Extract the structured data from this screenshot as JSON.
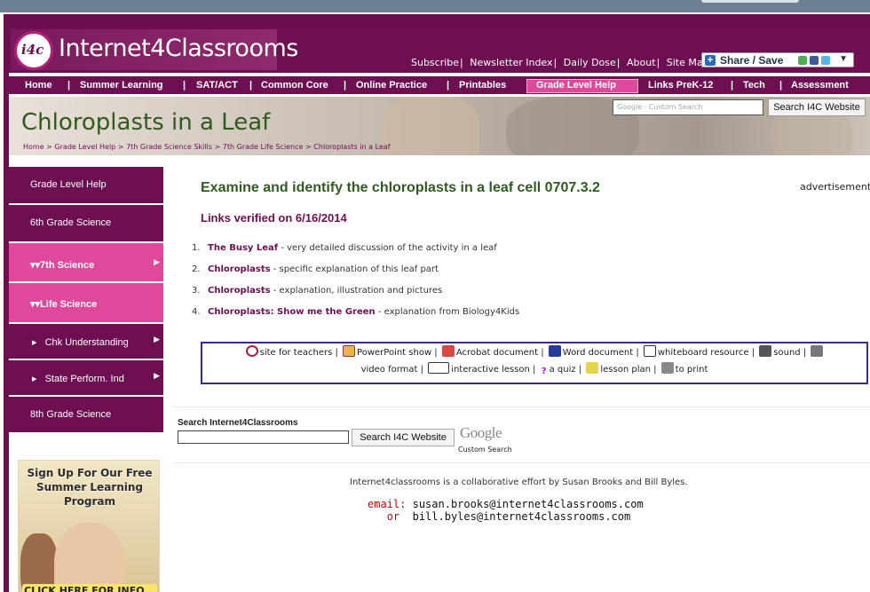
{
  "header": {
    "logo_mark": "i4c",
    "logo_text": "Internet4Classrooms",
    "top_links": [
      "Subscribe",
      "Newsletter Index",
      "Daily Dose",
      "About",
      "Site Map"
    ],
    "share_label": "Share / Save"
  },
  "nav": [
    {
      "label": "Home"
    },
    {
      "label": "Summer Learning"
    },
    {
      "label": "SAT/ACT"
    },
    {
      "label": "Common Core"
    },
    {
      "label": "Online Practice"
    },
    {
      "label": "Printables"
    },
    {
      "label": "Grade Level Help"
    },
    {
      "label": "Links PreK-12"
    },
    {
      "label": "Tech"
    },
    {
      "label": "Assessment"
    }
  ],
  "banner": {
    "title": "Chloroplasts in a Leaf",
    "breadcrumbs": [
      "Home",
      "Grade Level Help",
      "7th Grade Science Skills",
      "7th Grade Life Science",
      "Chloroplasts in a Leaf"
    ],
    "search_placeholder": "Custom Search",
    "search_google": "Google",
    "search_button": "Search I4C Website"
  },
  "sidebar": [
    {
      "label": "Grade Level Help"
    },
    {
      "label": "6th Grade Science"
    },
    {
      "label": "7th Science"
    },
    {
      "label": "Life Science"
    },
    {
      "label": "Chk Understanding"
    },
    {
      "label": "State Perform. Ind"
    },
    {
      "label": "8th Grade Science"
    }
  ],
  "promo": {
    "headline": "Sign Up For Our Free Summer Learning Program",
    "cta": "CLICK HERE FOR INFO..."
  },
  "main": {
    "heading": "Examine and identify the chloroplasts in a leaf cell 0707.3.2",
    "advertisement": "advertisement",
    "verified": "Links verified on 6/16/2014",
    "links": [
      {
        "num": "1.",
        "title": "The Busy Leaf",
        "desc": " - very detailed discussion of the activity in a leaf"
      },
      {
        "num": "2.",
        "title": "Chloroplasts",
        "desc": " - specific explanation of this leaf part"
      },
      {
        "num": "3.",
        "title": "Chloroplasts",
        "desc": " - explanation, illustration and pictures"
      },
      {
        "num": "4.",
        "title": "Chloroplasts: Show me the Green",
        "desc": "  - explanation from Biology4Kids"
      }
    ],
    "legend": [
      "site for teachers",
      "PowerPoint show",
      "Acrobat document",
      "Word document",
      "whiteboard resource",
      "sound",
      "video format",
      "interactive lesson",
      "a quiz",
      "lesson plan",
      "to print"
    ],
    "search_label": "Search Internet4Classrooms",
    "search_button": "Search I4C Website",
    "google": "Google",
    "custom_search": "Custom Search",
    "credit": "Internet4classrooms is a collaborative effort by Susan Brooks and Bill Byles.",
    "email_label": "email:",
    "email1": "susan.brooks@internet4classrooms.com",
    "or_label": "or",
    "email2": "bill.byles@internet4classrooms.com"
  },
  "colors": {
    "brand": "#6e0f51",
    "accent": "#e0489c",
    "heading": "#315a1f"
  }
}
